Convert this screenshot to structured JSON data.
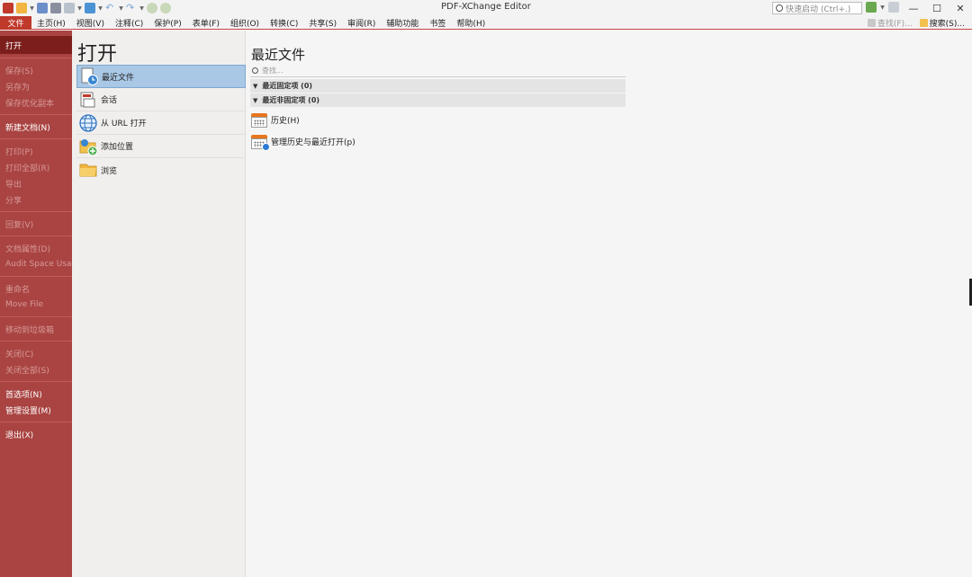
{
  "window": {
    "title": "PDF-XChange Editor",
    "quick_launch_placeholder": "快速启动 (Ctrl+.)",
    "min_glyph": "—",
    "max_glyph": "☐",
    "close_glyph": "✕"
  },
  "colors": {
    "accent": "#c0392b",
    "backstage_bg": "#a94442",
    "backstage_active": "#7c1f1c",
    "selected_item": "#a9c8e6"
  },
  "menubar": {
    "file": "文件",
    "items": [
      "主页(H)",
      "视图(V)",
      "注释(C)",
      "保护(P)",
      "表单(F)",
      "组织(O)",
      "转换(C)",
      "共享(S)",
      "审阅(R)",
      "辅助功能",
      "书签",
      "帮助(H)"
    ],
    "find": "查找(F)...",
    "search": "搜索(S)..."
  },
  "backstage": {
    "open": "打开",
    "save": "保存(S)",
    "save_as": "另存为",
    "save_optimized": "保存优化副本",
    "new_doc": "新建文档(N)",
    "print": "打印(P)",
    "print_all": "打印全部(R)",
    "export": "导出",
    "share": "分享",
    "revert": "回复(V)",
    "doc_props": "文档属性(D)",
    "audit": "Audit Space Usage",
    "rename": "重命名",
    "move_file": "Move File",
    "move_recycle": "移动到垃圾箱",
    "close": "关闭(C)",
    "close_all": "关闭全部(S)",
    "preferences": "首选项(N)",
    "manage_settings": "管理设置(M)",
    "exit": "退出(X)"
  },
  "open_panel": {
    "heading": "打开",
    "items": [
      {
        "label": "最近文件",
        "icon": "recent-file-icon"
      },
      {
        "label": "会话",
        "icon": "session-icon"
      },
      {
        "label": "从 URL 打开",
        "icon": "globe-icon"
      },
      {
        "label": "添加位置",
        "icon": "add-location-icon"
      },
      {
        "label": "浏览",
        "icon": "folder-icon"
      }
    ]
  },
  "recent": {
    "heading": "最近文件",
    "search_placeholder": "查找...",
    "pinned": "最近固定项 (0)",
    "unpinned": "最近非固定项 (0)",
    "history": "历史(H)",
    "manage_history": "管理历史与最近打开(p)"
  }
}
